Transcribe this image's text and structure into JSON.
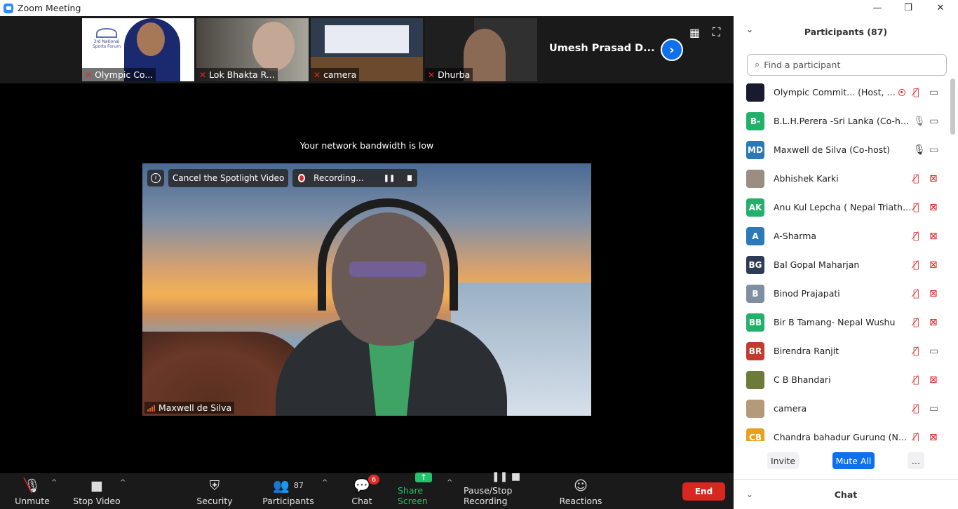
{
  "window": {
    "title": "Zoom Meeting",
    "minimize": "—",
    "restore": "❐",
    "close": "✕"
  },
  "strip": {
    "thumbs": [
      {
        "label": "Olympic Co..."
      },
      {
        "label": "Lok Bhakta R..."
      },
      {
        "label": "camera"
      },
      {
        "label": "Dhurba"
      }
    ],
    "name_tile": "Umesh Prasad D...",
    "next_icon": "›",
    "grid_icon": "▦",
    "fullscreen_icon": "⛶",
    "forum_text": "3rd National Sports Forum"
  },
  "notice": "Your network bandwidth is low",
  "spotlight": {
    "info_icon": "i",
    "cancel_label": "Cancel the Spotlight Video",
    "recording_label": "Recording...",
    "pause_icon": "❚❚",
    "speaker_name": "Maxwell de Silva"
  },
  "toolbar": {
    "unmute": "Unmute",
    "stop_video": "Stop Video",
    "security": "Security",
    "participants": "Participants",
    "participants_count": "87",
    "chat": "Chat",
    "chat_badge": "6",
    "share_screen": "Share Screen",
    "pause_stop_recording": "Pause/Stop Recording",
    "reactions": "Reactions",
    "end": "End",
    "caret": "^",
    "icons": {
      "mic": "🎙",
      "video": "■",
      "security": "⛨",
      "participants": "👥",
      "chat": "💬",
      "share": "↑",
      "rec": "❚❚ ■",
      "reactions": "☺"
    }
  },
  "panel": {
    "title": "Participants (87)",
    "collapse_icon": "⌄",
    "search_placeholder": "Find a participant",
    "search_icon": "⌕",
    "participants": [
      {
        "name": "Olympic Commit...  (Host, me)",
        "avatar": "",
        "color": "#1a1a2e",
        "mic": "off",
        "cam": "on",
        "host": true
      },
      {
        "name": "B.L.H.Perera -Sri Lanka (Co-host)",
        "avatar": "B-",
        "color": "#23b06a",
        "mic": "on",
        "cam": "on"
      },
      {
        "name": "Maxwell de Silva (Co-host)",
        "avatar": "MD",
        "color": "#2a7ab8",
        "mic": "on-dark",
        "cam": "on"
      },
      {
        "name": "Abhishek Karki",
        "avatar": "",
        "color": "#9a8d82",
        "mic": "off",
        "cam": "off"
      },
      {
        "name": "Anu Kul Lepcha ( Nepal Triathlo...",
        "avatar": "AK",
        "color": "#23b06a",
        "mic": "off",
        "cam": "off"
      },
      {
        "name": "A-Sharma",
        "avatar": "A",
        "color": "#2a7ab8",
        "mic": "off",
        "cam": "off"
      },
      {
        "name": "Bal Gopal Maharjan",
        "avatar": "BG",
        "color": "#2e3b55",
        "mic": "off",
        "cam": "off"
      },
      {
        "name": "Binod Prajapati",
        "avatar": "B",
        "color": "#7d8fa0",
        "mic": "off",
        "cam": "off"
      },
      {
        "name": "Bir B Tamang- Nepal Wushu",
        "avatar": "BB",
        "color": "#23b06a",
        "mic": "off",
        "cam": "off"
      },
      {
        "name": "Birendra Ranjit",
        "avatar": "BR",
        "color": "#c63a2e",
        "mic": "off",
        "cam": "on"
      },
      {
        "name": "C B Bhandari",
        "avatar": "",
        "color": "#6c7a3a",
        "mic": "off",
        "cam": "off"
      },
      {
        "name": "camera",
        "avatar": "",
        "color": "#b59a7a",
        "mic": "off",
        "cam": "on"
      },
      {
        "name": "Chandra bahadur Gurung (NSC)...",
        "avatar": "CB",
        "color": "#e8a020",
        "mic": "off",
        "cam": "off"
      }
    ],
    "invite": "Invite",
    "mute_all": "Mute All",
    "more": "...",
    "chat_section": "Chat",
    "chat_chevron": "⌄"
  },
  "colors": {
    "accent": "#0e71eb",
    "end": "#d9261f",
    "muted": "#e02828",
    "share": "#24c26a"
  }
}
